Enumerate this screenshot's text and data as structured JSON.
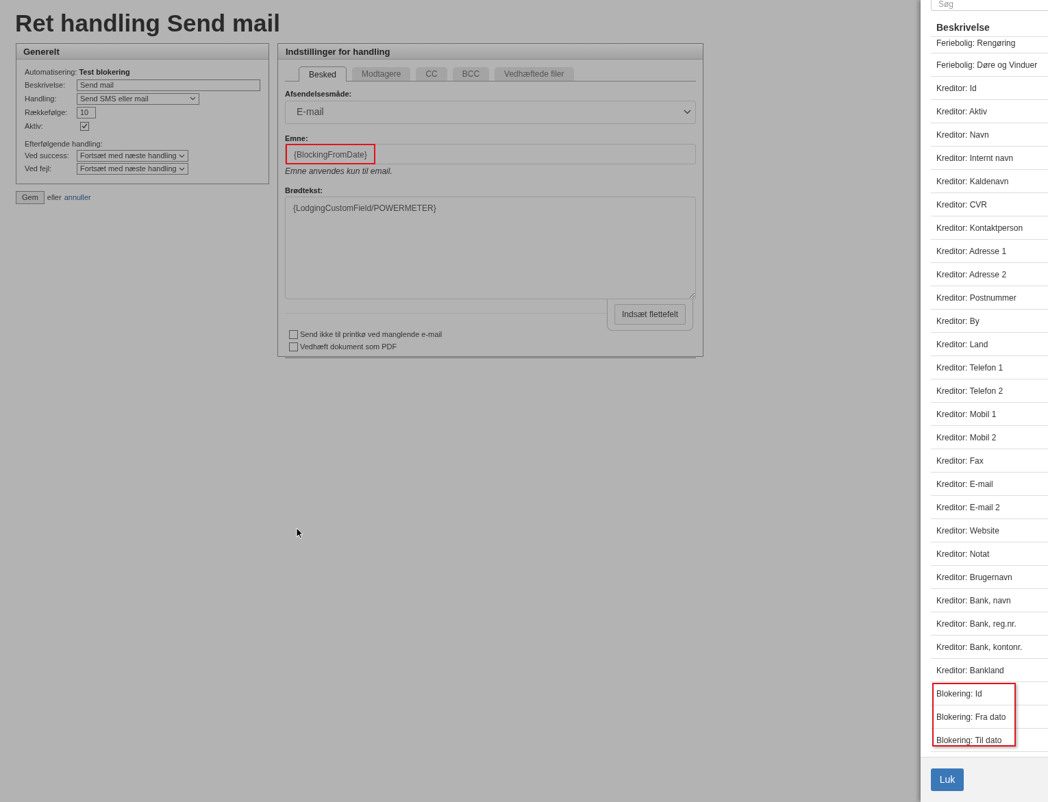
{
  "page_title": "Ret handling Send mail",
  "general": {
    "title": "Generelt",
    "automation_label": "Automatisering:",
    "automation_value": "Test blokering",
    "fields": [
      {
        "kind": "input",
        "label": "Beskrivelse:",
        "value": "Send mail"
      },
      {
        "kind": "select",
        "label": "Handling:",
        "value": "Send SMS eller mail"
      },
      {
        "kind": "input_small",
        "label": "Rækkefølge:",
        "value": "10"
      },
      {
        "kind": "checkbox",
        "label": "Aktiv:",
        "checked": true
      }
    ],
    "followup_heading": "Efterfølgende handling:",
    "followup": [
      {
        "label": "Ved success:",
        "value": "Fortsæt med næste handling"
      },
      {
        "label": "Ved fejl:",
        "value": "Fortsæt med næste handling"
      }
    ]
  },
  "save_button": "Gem",
  "or_text": "eller",
  "cancel_link": "annuller",
  "settings": {
    "title": "Indstillinger for handling",
    "tabs": [
      {
        "label": "Besked",
        "selected": true
      },
      {
        "label": "Modtagere",
        "selected": false
      },
      {
        "label": "CC",
        "selected": false
      },
      {
        "label": "BCC",
        "selected": false
      },
      {
        "label": "Vedhæftede filer",
        "selected": false
      }
    ],
    "send_method_label": "Afsendelsesmåde:",
    "send_method": "E-mail",
    "subject_label": "Emne:",
    "subject": {
      "value": "{BlockingFromDate}",
      "highlighted": true
    },
    "subject_hint": "Emne anvendes kun til email.",
    "body_label": "Brødtekst:",
    "body": "{LodgingCustomField/POWERMETER}",
    "insert_button": "Indsæt flettefelt",
    "options": [
      {
        "label": "Send ikke til printkø ved manglende e-mail",
        "checked": false
      },
      {
        "label": "Vedhæft dokument som PDF",
        "checked": false
      }
    ]
  },
  "merge_panel": {
    "search": {
      "placeholder": "Søg"
    },
    "heading": "Beskrivelse",
    "items": [
      {
        "label": "Feriebolig: Rengøring",
        "highlighted": false
      },
      {
        "label": "Feriebolig: Døre og Vinduer",
        "highlighted": false
      },
      {
        "label": "Kreditor: Id",
        "highlighted": false
      },
      {
        "label": "Kreditor: Aktiv",
        "highlighted": false
      },
      {
        "label": "Kreditor: Navn",
        "highlighted": false
      },
      {
        "label": "Kreditor: Internt navn",
        "highlighted": false
      },
      {
        "label": "Kreditor: Kaldenavn",
        "highlighted": false
      },
      {
        "label": "Kreditor: CVR",
        "highlighted": false
      },
      {
        "label": "Kreditor: Kontaktperson",
        "highlighted": false
      },
      {
        "label": "Kreditor: Adresse 1",
        "highlighted": false
      },
      {
        "label": "Kreditor: Adresse 2",
        "highlighted": false
      },
      {
        "label": "Kreditor: Postnummer",
        "highlighted": false
      },
      {
        "label": "Kreditor: By",
        "highlighted": false
      },
      {
        "label": "Kreditor: Land",
        "highlighted": false
      },
      {
        "label": "Kreditor: Telefon 1",
        "highlighted": false
      },
      {
        "label": "Kreditor: Telefon 2",
        "highlighted": false
      },
      {
        "label": "Kreditor: Mobil 1",
        "highlighted": false
      },
      {
        "label": "Kreditor: Mobil 2",
        "highlighted": false
      },
      {
        "label": "Kreditor: Fax",
        "highlighted": false
      },
      {
        "label": "Kreditor: E-mail",
        "highlighted": false
      },
      {
        "label": "Kreditor: E-mail 2",
        "highlighted": false
      },
      {
        "label": "Kreditor: Website",
        "highlighted": false
      },
      {
        "label": "Kreditor: Notat",
        "highlighted": false
      },
      {
        "label": "Kreditor: Brugernavn",
        "highlighted": false
      },
      {
        "label": "Kreditor: Bank, navn",
        "highlighted": false
      },
      {
        "label": "Kreditor: Bank, reg.nr.",
        "highlighted": false
      },
      {
        "label": "Kreditor: Bank, kontonr.",
        "highlighted": false
      },
      {
        "label": "Kreditor: Bankland",
        "highlighted": false
      },
      {
        "label": "Blokering: Id",
        "highlighted": true
      },
      {
        "label": "Blokering: Fra dato",
        "highlighted": true
      },
      {
        "label": "Blokering: Til dato",
        "highlighted": true
      }
    ],
    "close_button": "Luk"
  }
}
